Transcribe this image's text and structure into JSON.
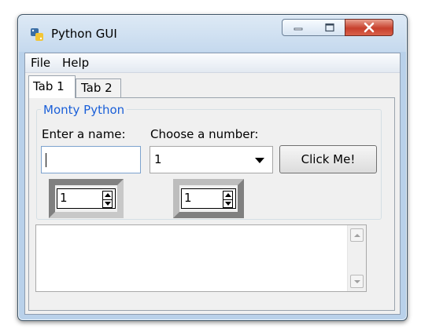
{
  "window": {
    "title": "Python GUI",
    "icon": "python-icon"
  },
  "menu": {
    "items": [
      "File",
      "Help"
    ]
  },
  "tabs": [
    {
      "label": "Tab 1",
      "selected": true
    },
    {
      "label": "Tab 2",
      "selected": false
    }
  ],
  "group": {
    "title": "Monty Python"
  },
  "form": {
    "name_label": "Enter a name:",
    "number_label": "Choose a number:",
    "name_value": "",
    "number_value": "1",
    "button_label": "Click Me!"
  },
  "spinboxes": [
    {
      "value": "1"
    },
    {
      "value": "1"
    }
  ],
  "colors": {
    "group_title": "#1a5fd8",
    "close_button": "#c7402d"
  }
}
